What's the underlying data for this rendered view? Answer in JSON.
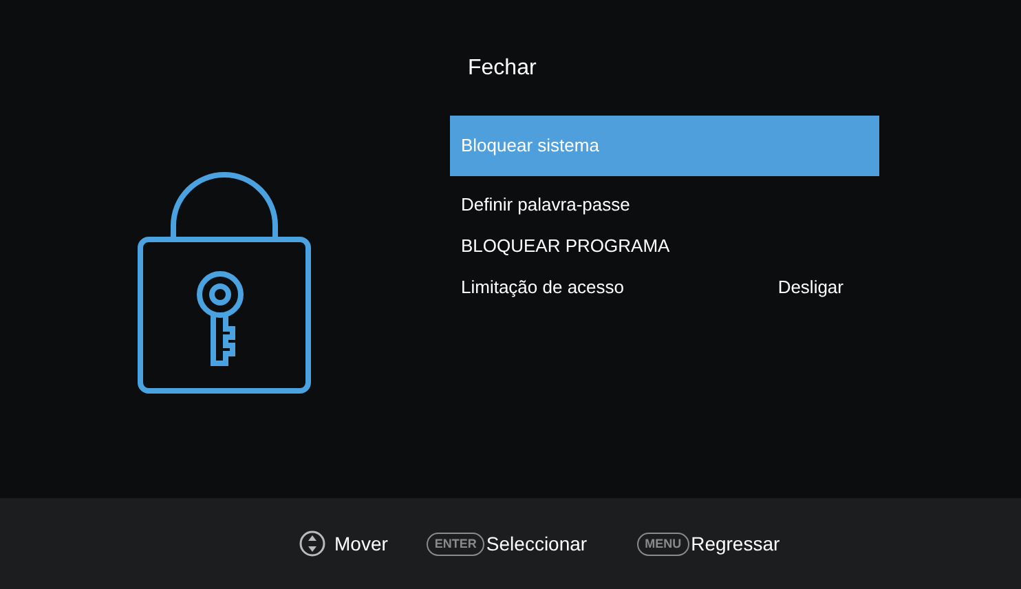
{
  "menu": {
    "title": "Fechar",
    "items": [
      {
        "label": "Bloquear sistema",
        "selected": true
      },
      {
        "label": "Definir palavra-passe",
        "selected": false
      },
      {
        "label": "BLOQUEAR PROGRAMA",
        "selected": false
      },
      {
        "label": "Limitação de acesso",
        "value": "Desligar",
        "selected": false
      }
    ]
  },
  "footer": [
    {
      "kind": "dpad",
      "label": "Mover"
    },
    {
      "kind": "key",
      "key": "ENTER",
      "label": "Seleccionar"
    },
    {
      "kind": "key",
      "key": "MENU",
      "label": "Regressar"
    }
  ]
}
